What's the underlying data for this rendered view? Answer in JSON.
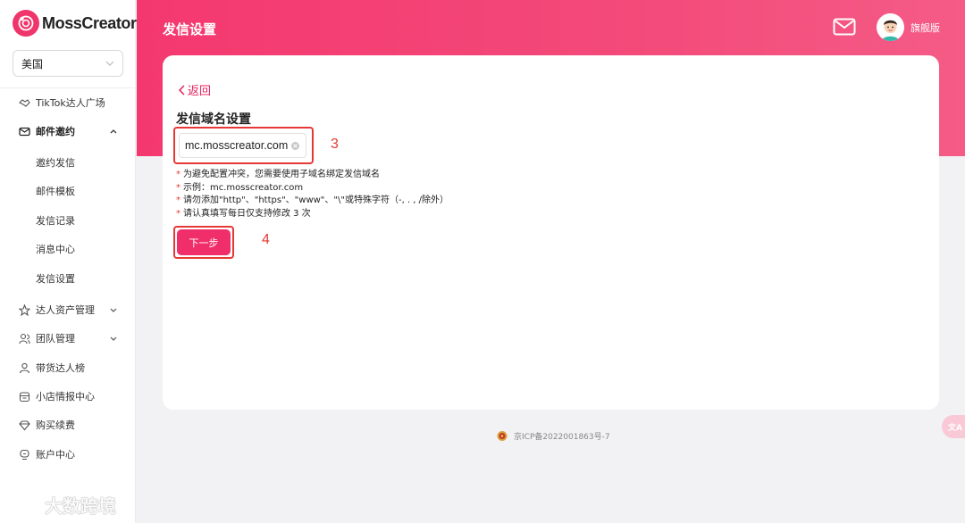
{
  "app": {
    "logo_text": "MossCreator"
  },
  "region": {
    "selected": "美国"
  },
  "sidebar": {
    "items": [
      {
        "label": "TikTok达人广场"
      },
      {
        "label": "邮件邀约"
      },
      {
        "label": "邀约发信"
      },
      {
        "label": "邮件模板"
      },
      {
        "label": "发信记录"
      },
      {
        "label": "消息中心"
      },
      {
        "label": "发信设置"
      },
      {
        "label": "达人资产管理"
      },
      {
        "label": "团队管理"
      },
      {
        "label": "带货达人榜"
      },
      {
        "label": "小店情报中心"
      },
      {
        "label": "购买续费"
      },
      {
        "label": "账户中心"
      }
    ]
  },
  "header": {
    "title": "发信设置",
    "plan": "旗舰版"
  },
  "main": {
    "back_label": "返回",
    "section_title": "发信域名设置",
    "domain_value": "mc.mosscreator.com",
    "notes": [
      "为避免配置冲突，您需要使用子域名绑定发信域名",
      "示例：mc.mosscreator.com",
      "请勿添加\"http\"、\"https\"、\"www\"、\"\\\"或特殊字符（-, . , /除外）",
      "请认真填写每日仅支持修改 3 次"
    ],
    "next_label": "下一步",
    "step3": "3",
    "step4": "4"
  },
  "footer": {
    "icp": "京ICP备2022001863号-7"
  },
  "translate": {
    "label": "文A"
  },
  "watermark": {
    "text": "大数跨境"
  },
  "colors": {
    "accent": "#f0356b",
    "highlight": "#e53935"
  }
}
